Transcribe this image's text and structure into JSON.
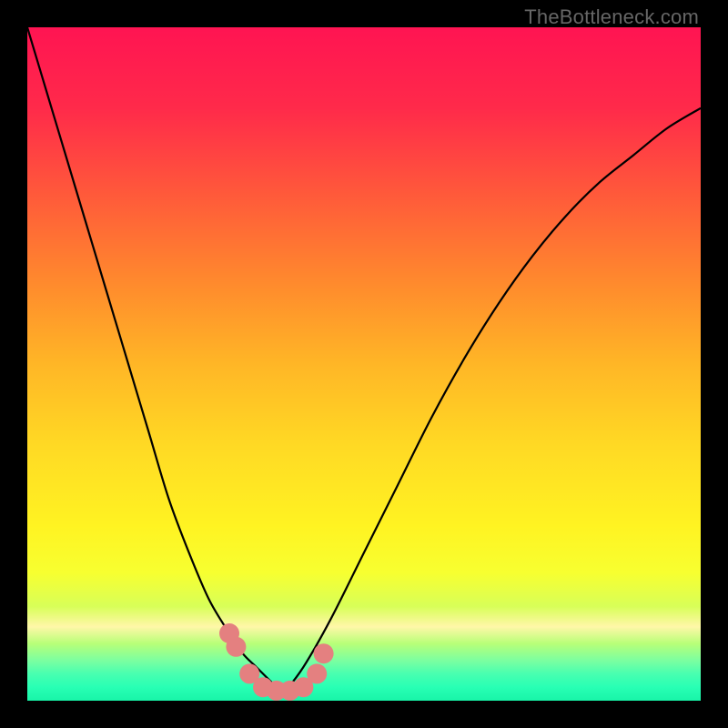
{
  "watermark": "TheBottleneck.com",
  "colors": {
    "frame": "#000000",
    "curve": "#000000",
    "marker": "#e48080",
    "gradient_top": "#ff1452",
    "gradient_bottom": "#18f5a8"
  },
  "chart_data": {
    "type": "line",
    "title": "",
    "xlabel": "",
    "ylabel": "",
    "xlim": [
      0,
      100
    ],
    "ylim": [
      0,
      100
    ],
    "grid": false,
    "legend": false,
    "series": [
      {
        "name": "left-curve",
        "x": [
          0,
          3,
          6,
          9,
          12,
          15,
          18,
          21,
          24,
          27,
          30,
          32,
          34,
          36,
          38
        ],
        "values": [
          100,
          90,
          80,
          70,
          60,
          50,
          40,
          30,
          22,
          15,
          10,
          7,
          5,
          3,
          1
        ]
      },
      {
        "name": "right-curve",
        "x": [
          38,
          41,
          45,
          50,
          55,
          60,
          65,
          70,
          75,
          80,
          85,
          90,
          95,
          100
        ],
        "values": [
          1,
          5,
          12,
          22,
          32,
          42,
          51,
          59,
          66,
          72,
          77,
          81,
          85,
          88
        ]
      },
      {
        "name": "markers",
        "x": [
          30,
          31,
          33,
          35,
          37,
          39,
          41,
          43,
          44
        ],
        "values": [
          10,
          8,
          4,
          2,
          1.5,
          1.5,
          2,
          4,
          7
        ]
      }
    ]
  }
}
